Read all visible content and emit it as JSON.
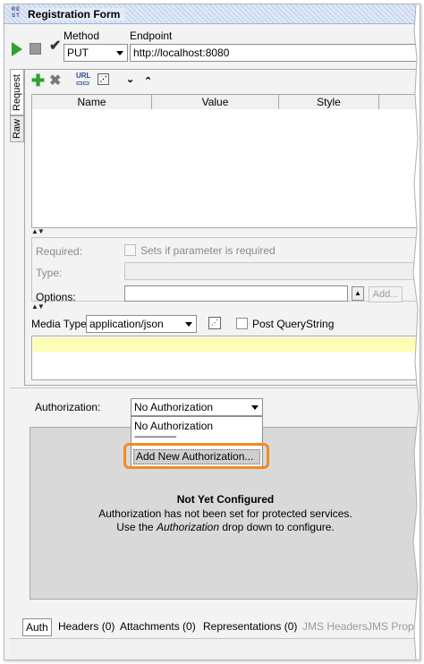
{
  "window": {
    "badge": "RE\nST",
    "title": "Registration Form"
  },
  "toolbar": {
    "method_label": "Method",
    "method_value": "PUT",
    "endpoint_label": "Endpoint",
    "endpoint_value": "http://localhost:8080"
  },
  "side_tabs": {
    "request": "Request",
    "raw": "Raw"
  },
  "params_grid": {
    "columns": [
      "Name",
      "Value",
      "Style"
    ]
  },
  "param_form": {
    "required_label": "Required:",
    "required_checkbox_text": "Sets if parameter is required",
    "type_label": "Type:",
    "options_label": "Options:",
    "add_button": "Add..."
  },
  "media": {
    "media_type_label": "Media Type",
    "media_type_value": "application/json",
    "post_querystring_label": "Post QueryString"
  },
  "auth": {
    "label": "Authorization:",
    "selected": "No Authorization",
    "dropdown_options": [
      "No Authorization",
      "--------------------",
      "Add New Authorization..."
    ],
    "info_title": "Not Yet Configured",
    "info_line1": "Authorization has not been set for protected services.",
    "info_line2_pre": "Use the ",
    "info_line2_em": "Authorization",
    "info_line2_post": " drop down to configure."
  },
  "bottom_tabs": [
    {
      "label": "Auth",
      "active": true
    },
    {
      "label": "Headers (0)"
    },
    {
      "label": "Attachments (0)"
    },
    {
      "label": "Representations (0)"
    },
    {
      "label": "JMS Headers",
      "disabled": true
    },
    {
      "label": "JMS Prop",
      "disabled": true
    }
  ],
  "colors": {
    "accent_highlight": "#f08a24",
    "run_green": "#2fa12f",
    "editor_highlight": "#fdfdb6"
  },
  "icons": [
    "run-icon",
    "stop-icon",
    "validate-icon",
    "add-icon",
    "delete-icon",
    "url-icon",
    "view-icon",
    "move-down-icon",
    "move-up-icon",
    "splitter-icon",
    "format-icon",
    "chevron-down-icon"
  ]
}
